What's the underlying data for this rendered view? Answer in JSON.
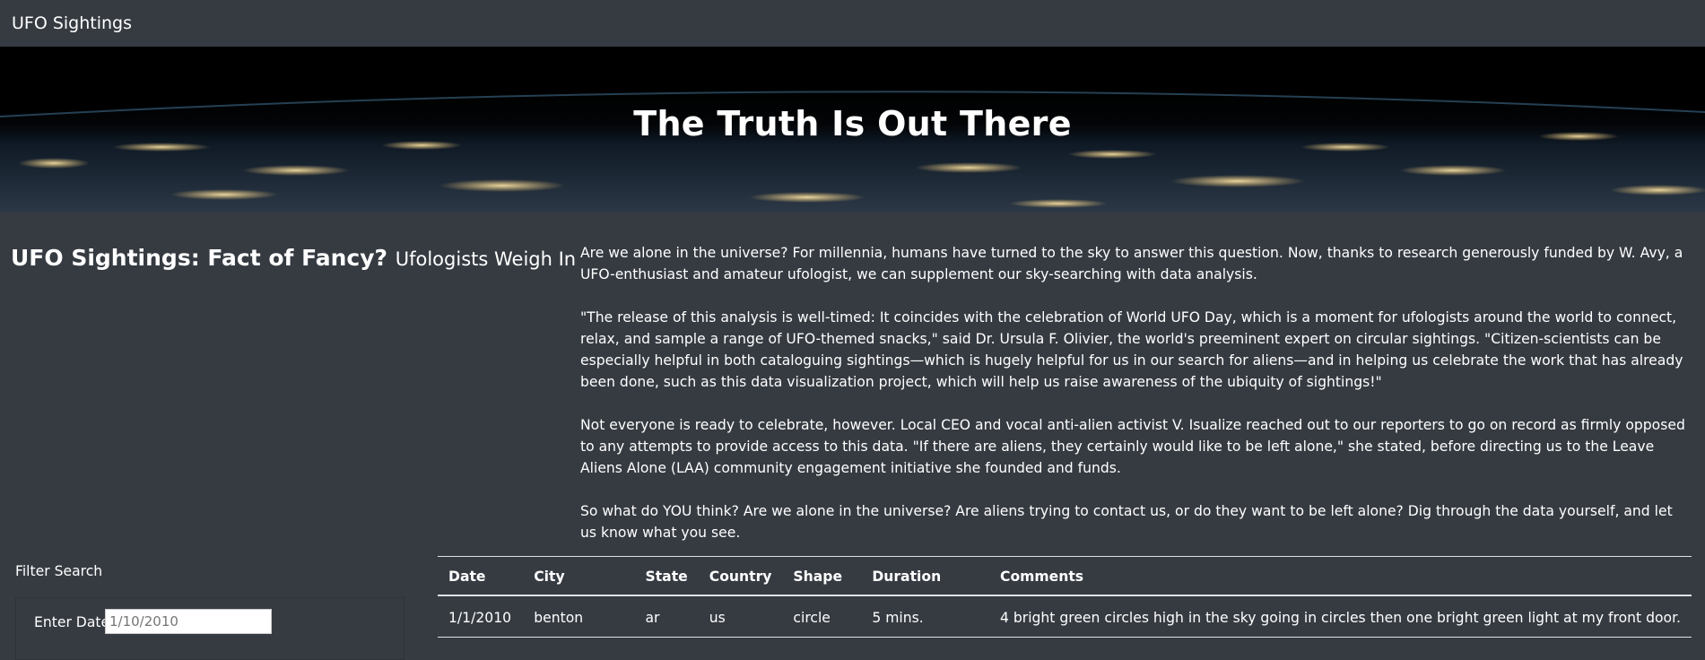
{
  "navbar": {
    "brand": "UFO Sightings"
  },
  "hero": {
    "title": "The Truth Is Out There"
  },
  "intro": {
    "heading": "UFO Sightings: Fact of Fancy?",
    "subheading": "Ufologists Weigh In",
    "paragraphs": [
      "Are we alone in the universe? For millennia, humans have turned to the sky to answer this question. Now, thanks to research generously funded by W. Avy, a UFO-enthusiast and amateur ufologist, we can supplement our sky-searching with data analysis.",
      "\"The release of this analysis is well-timed: It coincides with the celebration of World UFO Day, which is a moment for ufologists around the world to connect, relax, and sample a range of UFO-themed snacks,\" said Dr. Ursula F. Olivier, the world's preeminent expert on circular sightings. \"Citizen-scientists can be especially helpful in both cataloguing sightings—which is hugely helpful for us in our search for aliens—and in helping us celebrate the work that has already been done, such as this data visualization project, which will help us raise awareness of the ubiquity of sightings!\"",
      "Not everyone is ready to celebrate, however. Local CEO and vocal anti-alien activist V. Isualize reached out to our reporters to go on record as firmly opposed to any attempts to provide access to this data. \"If there are aliens, they certainly would like to be left alone,\" she stated, before directing us to the Leave Aliens Alone (LAA) community engagement initiative she founded and funds.",
      "So what do YOU think? Are we alone in the universe? Are aliens trying to contact us, or do they want to be left alone? Dig through the data yourself, and let us know what you see."
    ]
  },
  "filter": {
    "title": "Filter Search",
    "date_label": "Enter Date",
    "date_placeholder": "1/10/2010"
  },
  "table": {
    "headers": [
      "Date",
      "City",
      "State",
      "Country",
      "Shape",
      "Duration",
      "Comments"
    ],
    "rows": [
      [
        "1/1/2010",
        "benton",
        "ar",
        "us",
        "circle",
        "5 mins.",
        "4 bright green circles high in the sky going in circles then one bright green light at my front door."
      ]
    ]
  },
  "colors": {
    "background": "#363b42",
    "text": "#ffffff",
    "rule": "#dee2e6"
  }
}
